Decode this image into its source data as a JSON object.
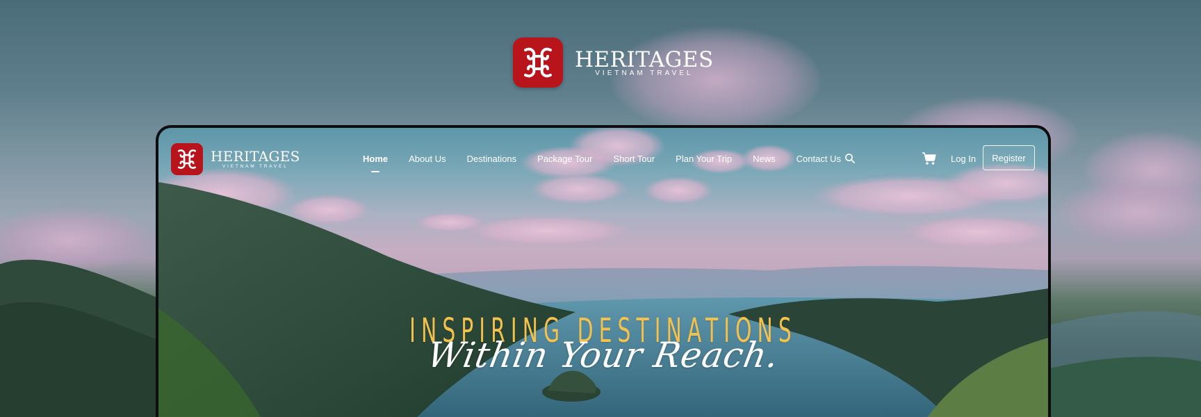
{
  "brand": {
    "name": "HERITAGES",
    "tagline": "VIETNAM TRAVEL",
    "color": "#b8141c"
  },
  "nav": {
    "links": [
      {
        "label": "Home",
        "active": true
      },
      {
        "label": "About Us",
        "active": false
      },
      {
        "label": "Destinations",
        "active": false
      },
      {
        "label": "Package Tour",
        "active": false
      },
      {
        "label": "Short Tour",
        "active": false
      },
      {
        "label": "Plan Your Trip",
        "active": false
      },
      {
        "label": "News",
        "active": false
      },
      {
        "label": "Contact Us",
        "active": false
      }
    ],
    "search_icon": "search-icon",
    "cart_icon": "cart-icon",
    "login_label": "Log In",
    "register_label": "Register"
  },
  "hero": {
    "title": "INSPIRING DESTINATIONS",
    "subtitle": "Within Your Reach.",
    "title_color": "#f2c14e"
  }
}
